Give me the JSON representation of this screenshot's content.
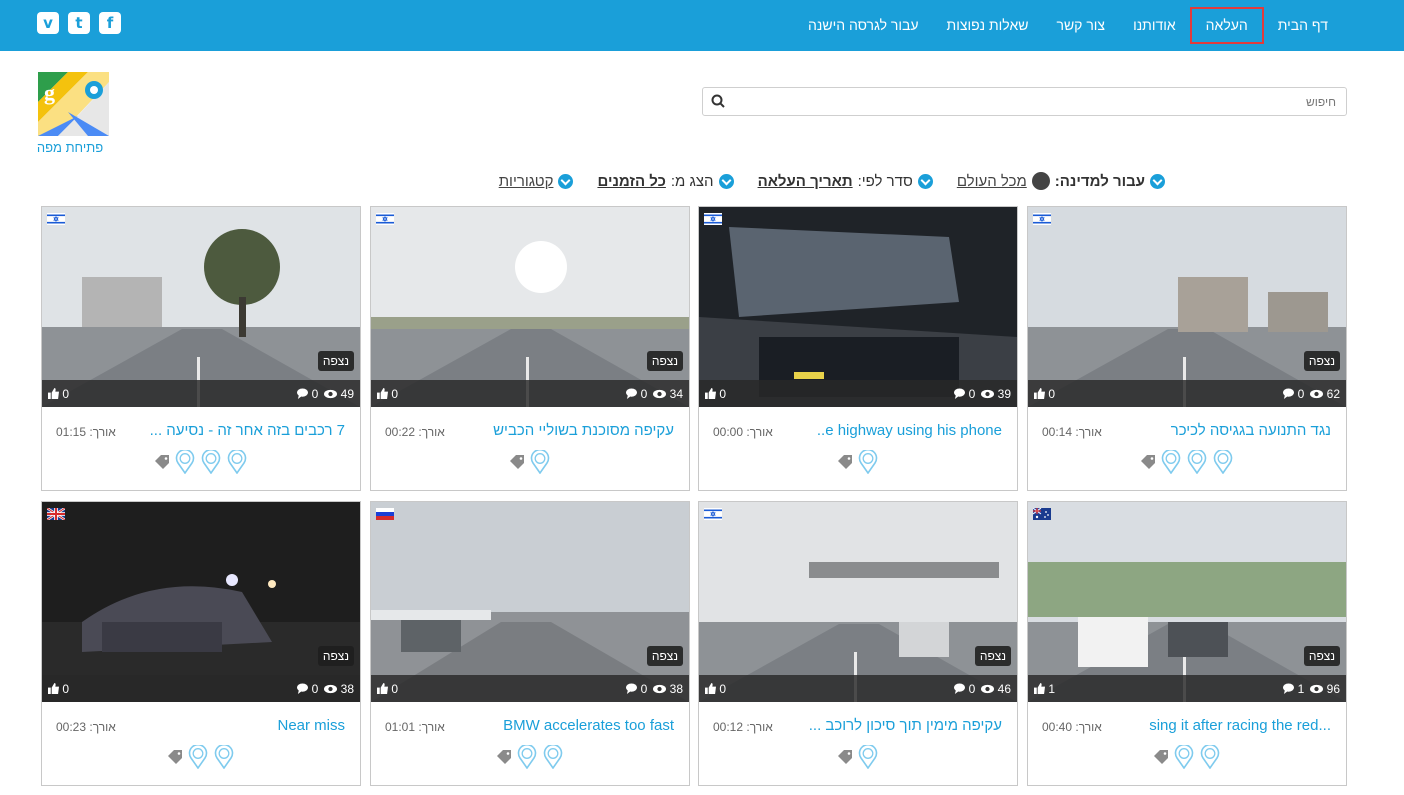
{
  "social": [
    {
      "name": "vimeo-icon",
      "glyph": "v"
    },
    {
      "name": "twitter-icon",
      "glyph": "t"
    },
    {
      "name": "facebook-icon",
      "glyph": "f"
    }
  ],
  "nav": [
    {
      "label": "דף הבית",
      "active": false
    },
    {
      "label": "העלאה",
      "active": true
    },
    {
      "label": "אודותנו",
      "active": false
    },
    {
      "label": "צור קשר",
      "active": false
    },
    {
      "label": "שאלות נפוצות",
      "active": false
    },
    {
      "label": "עבור לגרסה הישנה",
      "active": false
    }
  ],
  "map": {
    "label": "פתיחת מפה"
  },
  "search": {
    "placeholder": "חיפוש"
  },
  "filters": {
    "categories": "קטגוריות",
    "show_from_label": "הצג מ:",
    "show_from_value": "כל הזמנים",
    "sort_label": "סדר לפי:",
    "sort_value": "תאריך העלאה",
    "country_label": "עבור למדינה:",
    "country_value": "מכל העולם"
  },
  "watched_label": "נצפה",
  "length_label": "אורך:",
  "videos": [
    {
      "title": "נגד התנועה בגגיסה לכיכר",
      "length": "00:14",
      "likes": "0",
      "comments": "0",
      "views": "62",
      "flag": "il",
      "watched": true,
      "pins": 3,
      "scene": "city"
    },
    {
      "title": "e highway using his phone..",
      "length": "00:00",
      "likes": "0",
      "comments": "0",
      "views": "39",
      "flag": "il",
      "watched": false,
      "pins": 1,
      "scene": "car"
    },
    {
      "title": "עקיפה מסוכנת בשוליי הכביש",
      "length": "00:22",
      "likes": "0",
      "comments": "0",
      "views": "34",
      "flag": "il",
      "watched": true,
      "pins": 1,
      "scene": "sun"
    },
    {
      "title": "7 רכבים בזה אחר זה - נסיעה ...",
      "length": "01:15",
      "likes": "0",
      "comments": "0",
      "views": "49",
      "flag": "il",
      "watched": true,
      "pins": 3,
      "scene": "tree"
    },
    {
      "title": "...sing it after racing the red",
      "length": "00:40",
      "likes": "1",
      "comments": "1",
      "views": "96",
      "flag": "au",
      "watched": true,
      "pins": 2,
      "scene": "traffic"
    },
    {
      "title": "עקיפה מימין תוך סיכון לרוכב ...",
      "length": "00:12",
      "likes": "0",
      "comments": "0",
      "views": "46",
      "flag": "il",
      "watched": true,
      "pins": 1,
      "scene": "bridge"
    },
    {
      "title": "BMW accelerates too fast",
      "length": "01:01",
      "likes": "0",
      "comments": "0",
      "views": "38",
      "flag": "ru",
      "watched": true,
      "pins": 2,
      "scene": "snow"
    },
    {
      "title": "Near miss",
      "length": "00:23",
      "likes": "0",
      "comments": "0",
      "views": "38",
      "flag": "gb",
      "watched": true,
      "pins": 2,
      "scene": "night"
    }
  ]
}
